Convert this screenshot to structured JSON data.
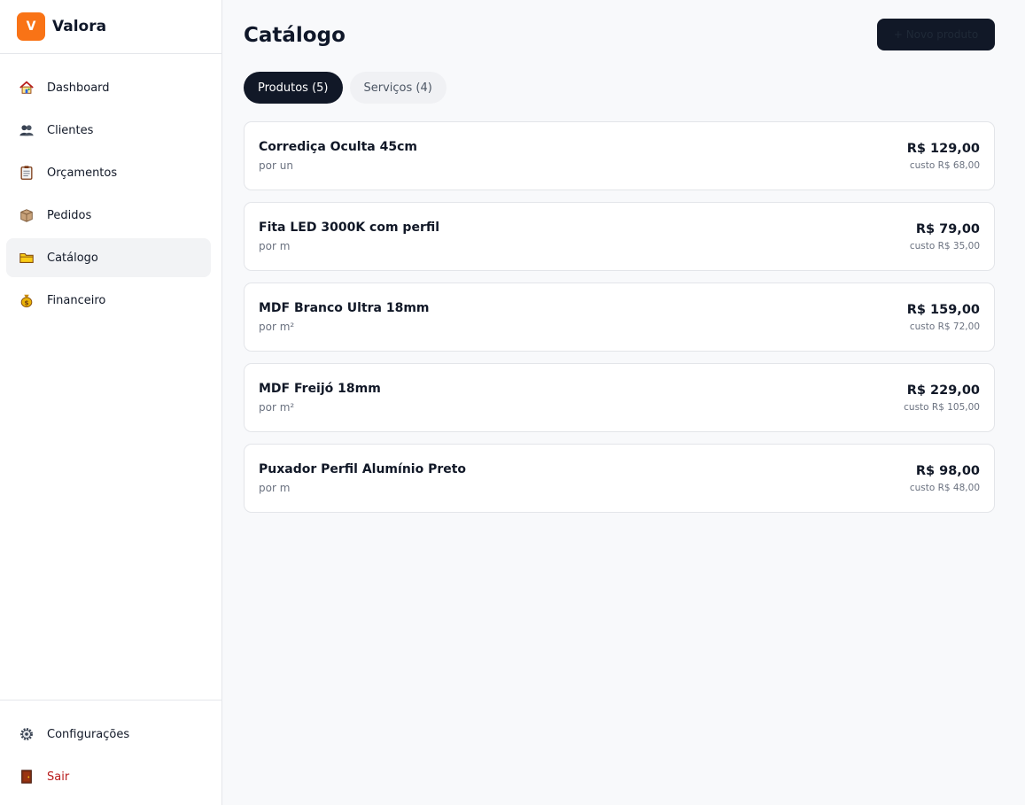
{
  "brand": {
    "logo_letter": "V",
    "name": "Valora",
    "logo_color": "#f97316"
  },
  "nav": {
    "items": [
      {
        "label": "Dashboard",
        "icon": "house-icon"
      },
      {
        "label": "Clientes",
        "icon": "users-icon"
      },
      {
        "label": "Orçamentos",
        "icon": "clipboard-icon"
      },
      {
        "label": "Pedidos",
        "icon": "package-icon"
      },
      {
        "label": "Catálogo",
        "icon": "folder-icon",
        "active": true
      },
      {
        "label": "Financeiro",
        "icon": "money-bag-icon"
      }
    ],
    "bottom": [
      {
        "label": "Configurações",
        "icon": "gear-icon"
      },
      {
        "label": "Sair",
        "icon": "door-icon"
      }
    ]
  },
  "page": {
    "title": "Catálogo",
    "new_button_label": "+ Novo produto"
  },
  "tabs": [
    {
      "label": "Produtos (5)",
      "active": true
    },
    {
      "label": "Serviços (4)",
      "active": false
    }
  ],
  "products": [
    {
      "name": "Corrediça Oculta 45cm",
      "unit": "por un",
      "price": "R$ 129,00",
      "cost": "custo R$ 68,00"
    },
    {
      "name": "Fita LED 3000K com perfil",
      "unit": "por m",
      "price": "R$ 79,00",
      "cost": "custo R$ 35,00"
    },
    {
      "name": "MDF Branco Ultra 18mm",
      "unit": "por m²",
      "price": "R$ 159,00",
      "cost": "custo R$ 72,00"
    },
    {
      "name": "MDF Freijó 18mm",
      "unit": "por m²",
      "price": "R$ 229,00",
      "cost": "custo R$ 105,00"
    },
    {
      "name": "Puxador Perfil Alumínio Preto",
      "unit": "por m",
      "price": "R$ 98,00",
      "cost": "custo R$ 48,00"
    }
  ],
  "colors": {
    "accent": "#f97316",
    "primary_dark": "#111827",
    "logout": "#b91c1c",
    "background": "#f8f9fb"
  }
}
